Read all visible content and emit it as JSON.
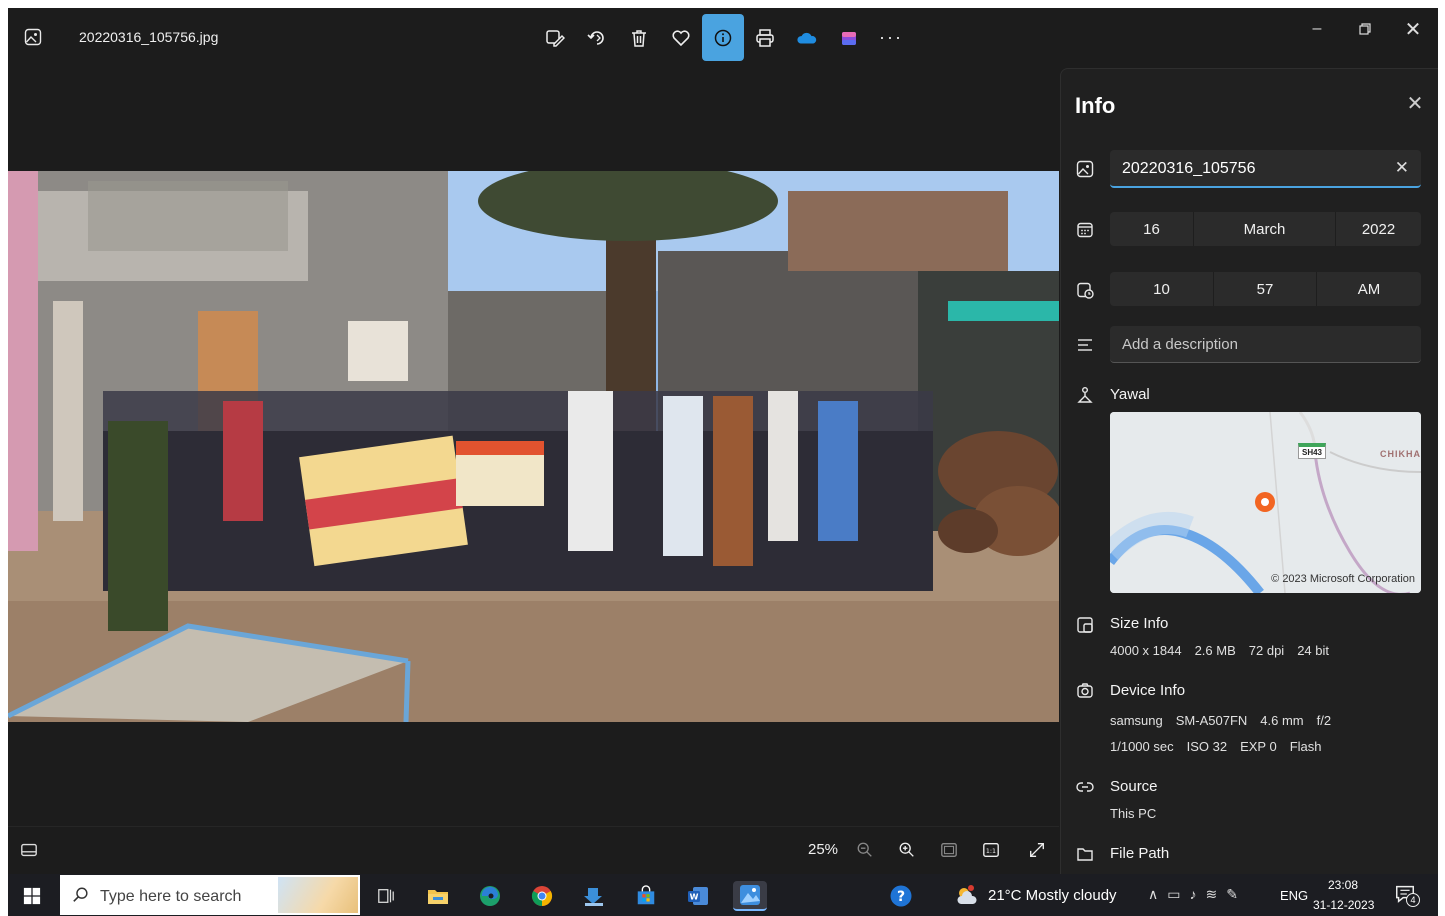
{
  "titlebar": {
    "file_name": "20220316_105756.jpg",
    "tools": [
      "edit-image",
      "rotate",
      "delete",
      "favorite",
      "info",
      "print",
      "onedrive",
      "clipchamp",
      "more"
    ],
    "window_controls": [
      "minimize",
      "restore",
      "close"
    ]
  },
  "bottombar": {
    "zoom_level": "25%"
  },
  "info": {
    "title": "Info",
    "name_value": "20220316_105756",
    "date": {
      "day": "16",
      "month": "March",
      "year": "2022"
    },
    "time": {
      "hour": "10",
      "minute": "57",
      "period": "AM"
    },
    "description_placeholder": "Add a description",
    "location": "Yawal",
    "map": {
      "credit": "© 2023 Microsoft Corporation",
      "shield": "SH43",
      "place": "CHIKHA"
    },
    "size": {
      "label": "Size Info",
      "dimensions": "4000 x 1844",
      "file_size": "2.6 MB",
      "dpi": "72 dpi",
      "bit": "24 bit"
    },
    "device": {
      "label": "Device Info",
      "make": "samsung",
      "model": "SM-A507FN",
      "focal": "4.6 mm",
      "aperture": "f/2",
      "shutter": "1/1000 sec",
      "iso": "ISO 32",
      "exposure": "EXP 0",
      "flash": "Flash"
    },
    "source": {
      "label": "Source",
      "value": "This PC"
    },
    "file_path": {
      "label": "File Path"
    }
  },
  "taskbar": {
    "search_placeholder": "Type here to search",
    "weather": "21°C  Mostly cloudy",
    "language": "ENG",
    "time": "23:08",
    "date": "31-12-2023",
    "notification_count": "4"
  },
  "colors": {
    "accent": "#4aa3e0",
    "background": "#1c1c1c",
    "panel": "#202020",
    "taskbar": "#1c1d22"
  }
}
